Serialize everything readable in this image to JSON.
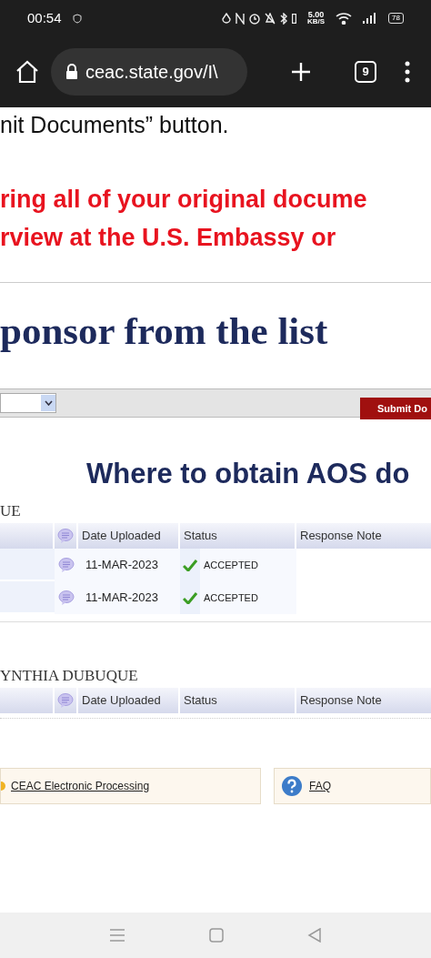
{
  "status_bar": {
    "time": "00:54",
    "net_speed": "5.00",
    "net_unit": "KB/S",
    "battery": "78"
  },
  "browser": {
    "url": "ceac.state.gov/I\\",
    "tab_count": "9"
  },
  "page": {
    "intro": "nit Documents” button.",
    "warning_lines": [
      "ring all of your original docume",
      "rview at the U.S. Embassy or"
    ],
    "section_title": "ponsor from the list",
    "submit_button": "Submit Do",
    "aos_link": "Where to obtain AOS do",
    "groups": [
      {
        "name": "UE",
        "columns": [
          "Date Uploaded",
          "Status",
          "Response Note"
        ],
        "rows": [
          {
            "date": "11-MAR-2023",
            "status": "ACCEPTED"
          },
          {
            "date": "11-MAR-2023",
            "status": "ACCEPTED"
          }
        ]
      },
      {
        "name": "YNTHIA DUBUQUE",
        "columns": [
          "Date Uploaded",
          "Status",
          "Response Note"
        ]
      }
    ],
    "footer_links": [
      "CEAC Electronic Processing",
      "FAQ"
    ]
  }
}
